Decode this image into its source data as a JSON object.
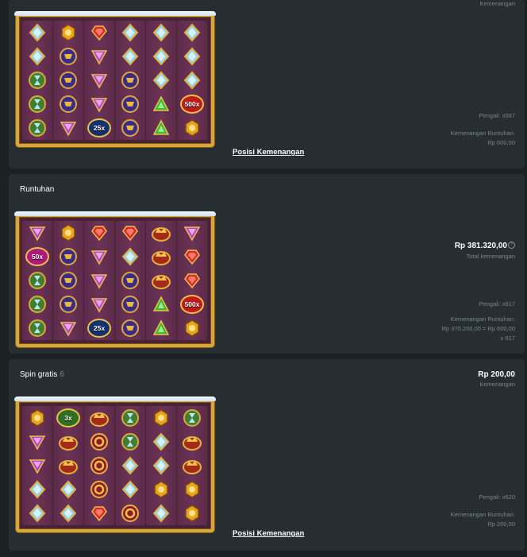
{
  "panels": [
    {
      "id": "p1",
      "title": "",
      "amount": "",
      "amount_sub": "Kemenangan",
      "multiplier": "Pengali: x567",
      "tumble_label": "Kemenangan Runtuhan:",
      "tumble_value": "Rp 600,00",
      "tumble_extra": "",
      "link": "Posisi Kemenangan",
      "grid": [
        [
          "diamond",
          "hex",
          "ruby",
          "diamond",
          "diamond",
          "diamond"
        ],
        [
          "diamond",
          "cup",
          "amethyst",
          "diamond",
          "diamond",
          "diamond"
        ],
        [
          "sand",
          "cup",
          "amethyst",
          "cup",
          "diamond",
          "diamond"
        ],
        [
          "sand",
          "cup",
          "amethyst",
          "cup",
          "emerald",
          "m500"
        ],
        [
          "sand",
          "amethyst",
          "m25",
          "cup",
          "emerald",
          "hex"
        ]
      ],
      "mults": {
        "m500": "500x",
        "m25": "25x"
      }
    },
    {
      "id": "p2",
      "title": "Runtuhan",
      "amount": "Rp 381.320,00",
      "amount_sub": "Total kemenangan",
      "multiplier": "Pengali: x617",
      "tumble_label": "Kemenangan Runtuhan:",
      "tumble_value": "Rp 370.200,00 = Rp 600,00",
      "tumble_extra": "x 617",
      "link": "",
      "grid": [
        [
          "amethyst",
          "hex",
          "ruby",
          "ruby",
          "crown",
          "amethyst"
        ],
        [
          "m50",
          "cup",
          "amethyst",
          "diamond",
          "crown",
          "ruby"
        ],
        [
          "sand",
          "cup",
          "amethyst",
          "cup",
          "crown",
          "ruby"
        ],
        [
          "sand",
          "cup",
          "amethyst",
          "cup",
          "emerald",
          "m500"
        ],
        [
          "sand",
          "amethyst",
          "m25",
          "cup",
          "emerald",
          "hex"
        ]
      ],
      "mults": {
        "m500": "500x",
        "m25": "25x",
        "m50": "50x"
      }
    },
    {
      "id": "p3",
      "title": "Spin gratis",
      "title_count": "6",
      "amount": "Rp 200,00",
      "amount_sub": "Kemenangan",
      "multiplier": "Pengali: x620",
      "tumble_label": "Kemenangan Runtuhan:",
      "tumble_value": "Rp 200,00",
      "tumble_extra": "",
      "link": "Posisi Kemenangan",
      "grid": [
        [
          "hex",
          "m3",
          "crown",
          "sand",
          "hex",
          "sand"
        ],
        [
          "amethyst",
          "crown",
          "ring",
          "sand",
          "diamond",
          "crown"
        ],
        [
          "amethyst",
          "crown",
          "ring",
          "diamond",
          "diamond",
          "crown"
        ],
        [
          "diamond",
          "diamond",
          "ring",
          "diamond",
          "hex",
          "hex"
        ],
        [
          "diamond",
          "diamond",
          "ruby",
          "ring",
          "diamond",
          "hex"
        ]
      ],
      "mults": {
        "m3": "3x"
      }
    }
  ],
  "colors": {
    "background": "#1c2224",
    "panel": "#262e31",
    "board_frame": "#d7a73b",
    "board_bg": "#4a2238",
    "muted_text": "#7a8589"
  }
}
